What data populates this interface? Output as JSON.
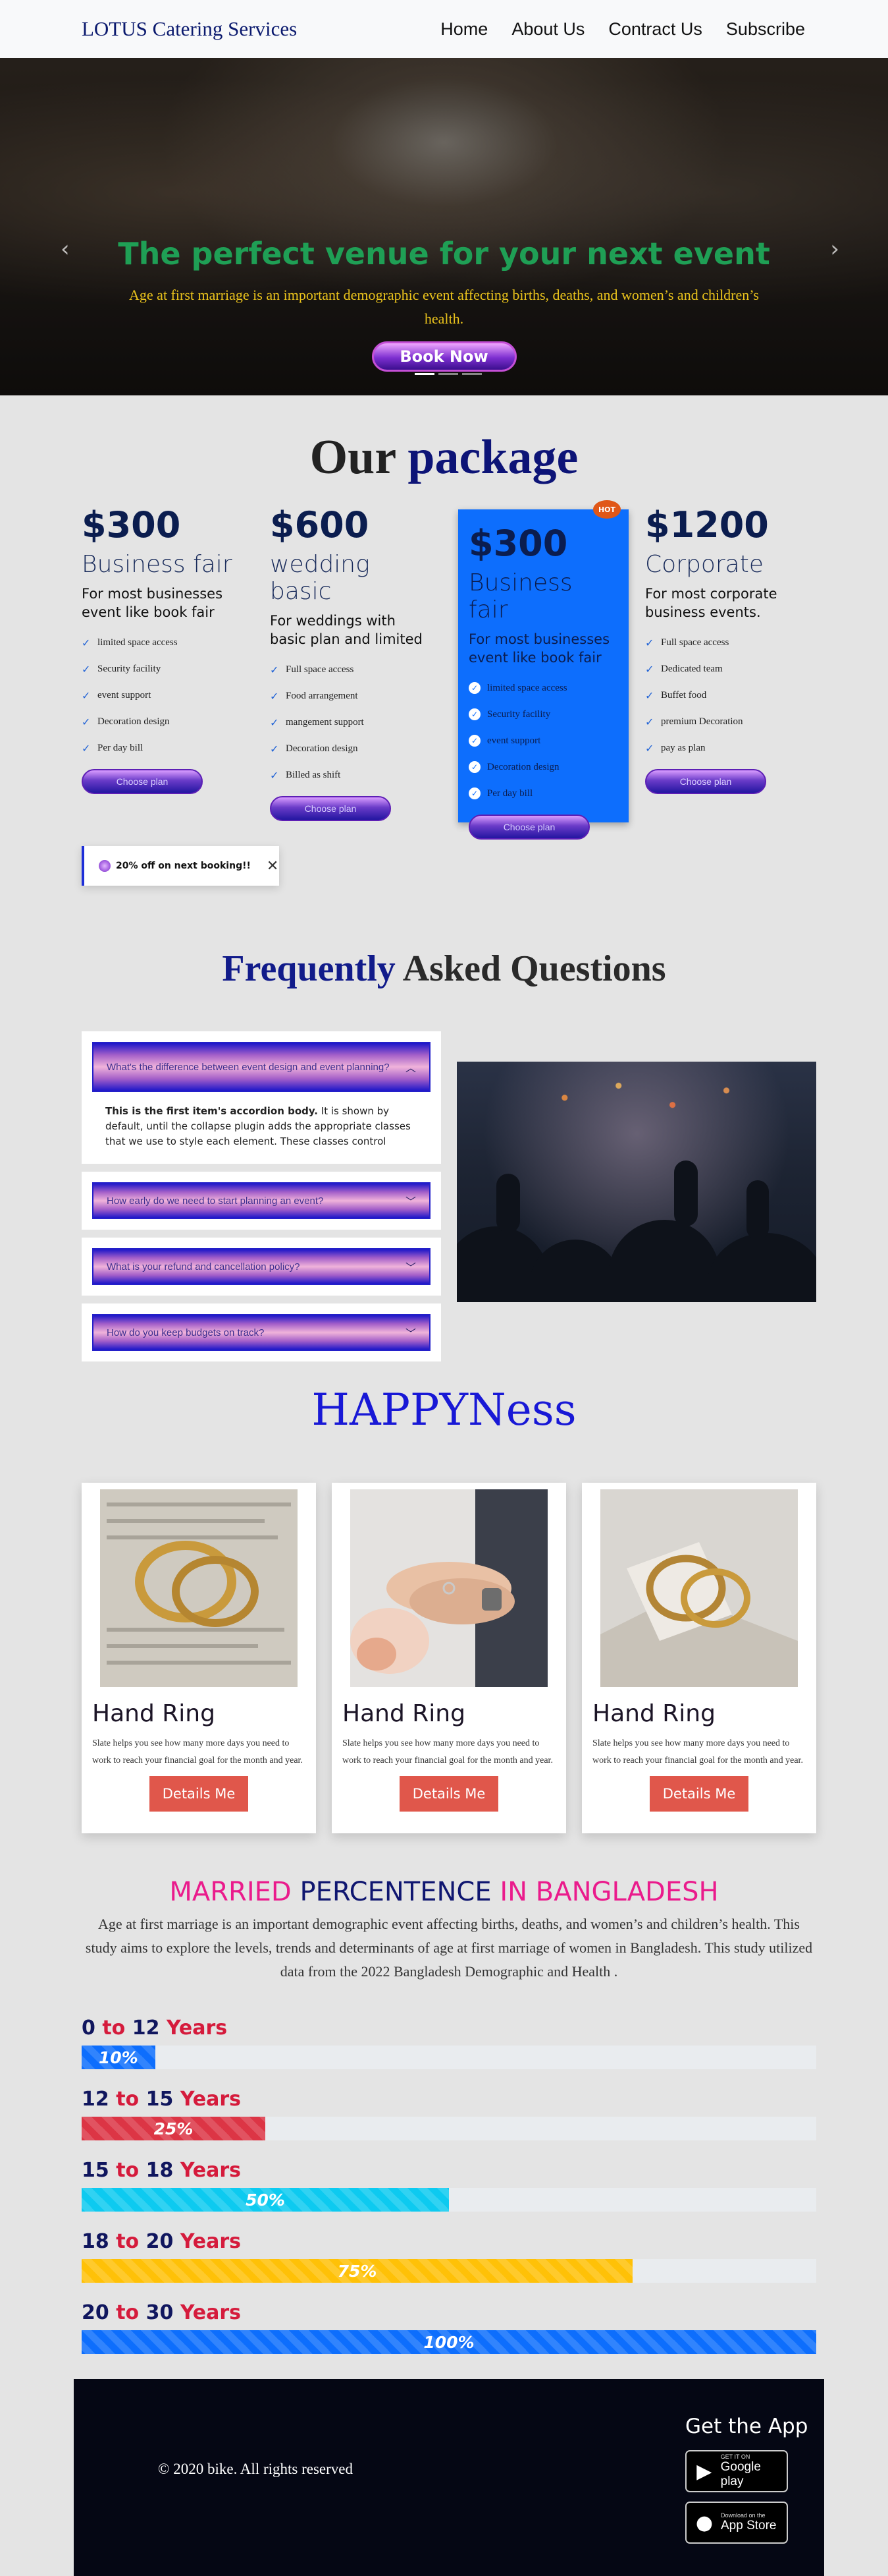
{
  "nav": {
    "brand": "LOTUS Catering Services",
    "links": [
      "Home",
      "About Us",
      "Contract Us",
      "Subscribe"
    ]
  },
  "hero": {
    "title": "The perfect venue for your next event",
    "subtitle": "Age at first marriage is an important demographic event affecting births, deaths, and women’s and children’s health.",
    "button": "Book Now",
    "prev_icon": "chevron-left-icon",
    "next_icon": "chevron-right-icon"
  },
  "packages": {
    "title_part1": "Our",
    "title_part2": "package",
    "hot_badge": "HOT",
    "choose_label": "Choose plan",
    "items": [
      {
        "price": "$300",
        "name": "Business fair",
        "desc": "For most businesses event like book fair",
        "features": [
          "limited space access",
          "Security facility",
          "event support",
          "Decoration design",
          "Per day bill"
        ]
      },
      {
        "price": "$600",
        "name": "wedding basic",
        "desc": "For weddings with basic plan and limited",
        "features": [
          "Full space access",
          "Food arrangement",
          "mangement support",
          "Decoration design",
          "Billed as shift"
        ]
      },
      {
        "price": "$300",
        "name": "Business fair",
        "desc": "For most businesses event like book fair",
        "features": [
          "limited space access",
          "Security facility",
          "event support",
          "Decoration design",
          "Per day bill"
        ]
      },
      {
        "price": "$1200",
        "name": "Corporate",
        "desc": "For most corporate business events.",
        "features": [
          "Full space access",
          "Dedicated team",
          "Buffet food",
          "premium Decoration",
          "pay as plan"
        ]
      }
    ]
  },
  "toast": {
    "text": "20% off on next booking!!",
    "close_icon": "close-icon"
  },
  "faq": {
    "title_part1": "Frequently",
    "title_part2": "Asked Questions",
    "items": [
      {
        "question": "What's the difference between event design and event planning?",
        "open": true
      },
      {
        "question": "How early do we need to start planning an event?",
        "open": false
      },
      {
        "question": "What is your refund and cancellation policy?",
        "open": false
      },
      {
        "question": "How do you keep budgets on track?",
        "open": false
      }
    ],
    "answer_bold": "This is the first item's accordion body.",
    "answer_rest": " It is shown by default, until the collapse plugin adds the appropriate classes that we use to style each element. These classes control"
  },
  "happiness": {
    "title": "HAPPYNess",
    "cards": [
      {
        "title": "Hand Ring",
        "text": "Slate helps you see how many more days you need to work to reach your financial goal for the month and year.",
        "button": "Details Me"
      },
      {
        "title": "Hand Ring",
        "text": "Slate helps you see how many more days you need to work to reach your financial goal for the month and year.",
        "button": "Details Me"
      },
      {
        "title": "Hand Ring",
        "text": "Slate helps you see how many more days you need to work to reach your financial goal for the month and year.",
        "button": "Details Me"
      }
    ]
  },
  "married": {
    "title_pink1": "MARRIED",
    "title_navy": "PERCENTENCE",
    "title_pink2": "IN BANGLADESH",
    "text": "Age at first marriage is an important demographic event affecting births, deaths, and women’s and children’s health. This study aims to explore the levels, trends and determinants of age at first marriage of women in Bangladesh. This study utilized data from the 2022 Bangladesh Demographic and Health .",
    "bars": [
      {
        "from": "0",
        "to_word": "to",
        "to": "12",
        "unit": "Years",
        "label": "10%",
        "value": 10,
        "color": "#0d6efd"
      },
      {
        "from": "12",
        "to_word": "to",
        "to": "15",
        "unit": "Years",
        "label": "25%",
        "value": 25,
        "color": "#dc3545"
      },
      {
        "from": "15",
        "to_word": "to",
        "to": "18",
        "unit": "Years",
        "label": "50%",
        "value": 50,
        "color": "#0dcaf0"
      },
      {
        "from": "18",
        "to_word": "to",
        "to": "20",
        "unit": "Years",
        "label": "75%",
        "value": 75,
        "color": "#ffc107"
      },
      {
        "from": "20",
        "to_word": "to",
        "to": "30",
        "unit": "Years",
        "label": "100%",
        "value": 100,
        "color": "#0d6efd"
      }
    ]
  },
  "footer": {
    "copyright": "© 2020 bike. All rights reserved",
    "get_app": "Get the App",
    "google_small": "GET IT ON",
    "google_big": "Google play",
    "apple_small": "Download on the",
    "apple_big": "App Store"
  }
}
